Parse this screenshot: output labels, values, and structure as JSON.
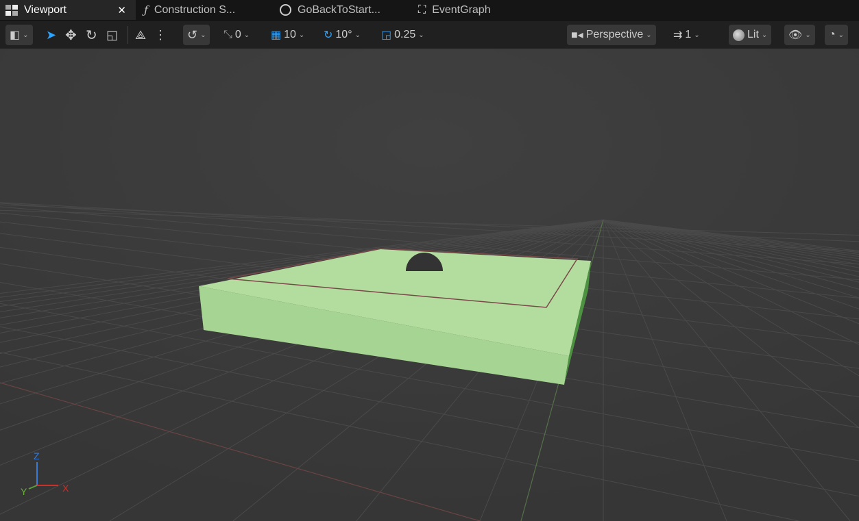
{
  "tabs": [
    {
      "label": "Viewport",
      "icon": "viewport-icon",
      "active": true
    },
    {
      "label": "Construction S...",
      "icon": "function-icon"
    },
    {
      "label": "GoBackToStart...",
      "icon": "clock-icon"
    },
    {
      "label": "EventGraph",
      "icon": "graph-icon"
    }
  ],
  "toolbar": {
    "grid_snap_angle": "0",
    "grid_snap": "10",
    "rotation_snap": "10°",
    "scale_snap": "0.25",
    "view_mode": "Perspective",
    "camera_speed": "1",
    "lighting": "Lit"
  },
  "gizmo": {
    "z": "Z",
    "y": "Y",
    "x": "X"
  },
  "colors": {
    "accent": "#2ba3ff",
    "mesh": "#b0dc9e",
    "mesh_side": "#4a8f3f"
  }
}
